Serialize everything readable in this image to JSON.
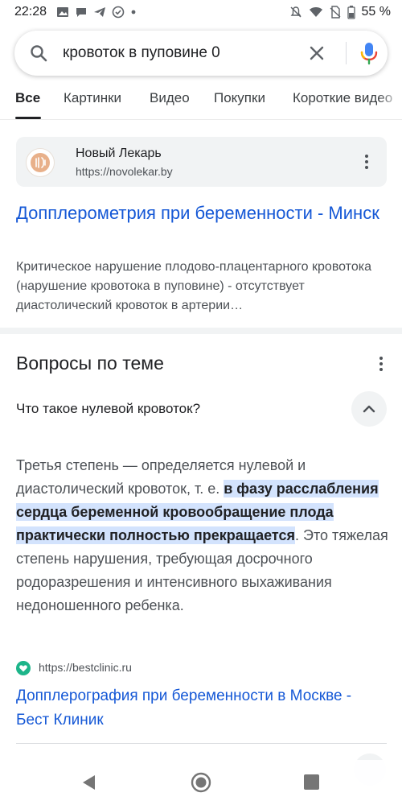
{
  "status_bar": {
    "time": "22:28",
    "battery": "55 %",
    "left_icons": [
      "image-icon",
      "chat-icon",
      "telegram-icon",
      "check-circle-icon",
      "dot-icon"
    ],
    "right_icons": [
      "mute-icon",
      "wifi-icon",
      "no-sim-icon",
      "battery-icon"
    ]
  },
  "search": {
    "query": "кровоток в пуповине 0"
  },
  "tabs": [
    {
      "label": "Все",
      "active": true
    },
    {
      "label": "Картинки"
    },
    {
      "label": "Видео"
    },
    {
      "label": "Покупки"
    },
    {
      "label": "Короткие видео"
    }
  ],
  "result1": {
    "site_name": "Новый Лекарь",
    "site_url": "https://novolekar.by",
    "title": "Допплерометрия при беременности - Минск",
    "snippet": "Критическое нарушение плодово-плацентарного кровотока (нарушение кровотока в пуповине) - отсутствует диастолический кровоток в артерии…"
  },
  "related_questions": {
    "title": "Вопросы по теме",
    "question": "Что такое нулевой кровоток?",
    "answer_before": "Третья степень — определяется нулевой и диастолический кровоток, т. е. ",
    "answer_highlight": "в фазу расслабления сердца беременной кровообращение плода практически полностью прекращается",
    "answer_after": ". Это тяжелая степень нарушения, требующая досрочного родоразрешения и интенсивного выхаживания недоношенного ребенка.",
    "source_url": "https://bestclinic.ru",
    "source_title": "Допплерография при беременности в Москве - Бест Клиник"
  },
  "colors": {
    "link": "#1558d6",
    "highlight": "#d3e3fd",
    "bestclinic_icon": "#1db58a"
  }
}
